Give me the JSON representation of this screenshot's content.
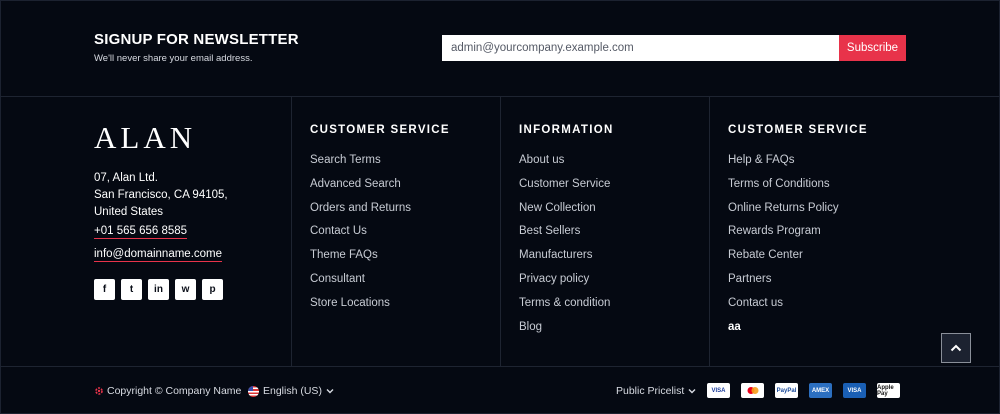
{
  "newsletter": {
    "title": "SIGNUP FOR NEWSLETTER",
    "subtitle": "We'll never share your email address.",
    "email_placeholder": "admin@yourcompany.example.com",
    "subscribe_label": "Subscribe"
  },
  "brand": {
    "logo_text": "ALAN",
    "address_line1": "07, Alan Ltd.",
    "address_line2": "San Francisco, CA 94105,",
    "address_line3": "United States",
    "phone": "+01 565 656 8585",
    "email": "info@domainname.come",
    "socials": [
      {
        "icon": "facebook-icon",
        "glyph": "f"
      },
      {
        "icon": "twitter-icon",
        "glyph": "t"
      },
      {
        "icon": "linkedin-icon",
        "glyph": "in"
      },
      {
        "icon": "whatsapp-icon",
        "glyph": "w"
      },
      {
        "icon": "pinterest-icon",
        "glyph": "p"
      }
    ]
  },
  "columns": [
    {
      "title": "CUSTOMER SERVICE",
      "items": [
        "Search Terms",
        "Advanced Search",
        "Orders and Returns",
        "Contact Us",
        "Theme FAQs",
        "Consultant",
        "Store Locations"
      ]
    },
    {
      "title": "INFORMATION",
      "items": [
        "About us",
        "Customer Service",
        "New Collection",
        "Best Sellers",
        "Manufacturers",
        "Privacy policy",
        "Terms & condition",
        "Blog"
      ]
    },
    {
      "title": "CUSTOMER SERVICE",
      "items": [
        "Help & FAQs",
        "Terms of Conditions",
        "Online Returns Policy",
        "Rewards Program",
        "Rebate Center",
        "Partners",
        "Contact us",
        "aa"
      ]
    }
  ],
  "bottom": {
    "copyright": "Copyright © Company Name",
    "language": "English (US)",
    "pricelist": "Public Pricelist",
    "payments": [
      "VISA",
      "mastercard",
      "PayPal",
      "AMEX",
      "VISA",
      "Apple Pay"
    ]
  },
  "colors": {
    "background": "#050912",
    "accent": "#e8334a"
  }
}
